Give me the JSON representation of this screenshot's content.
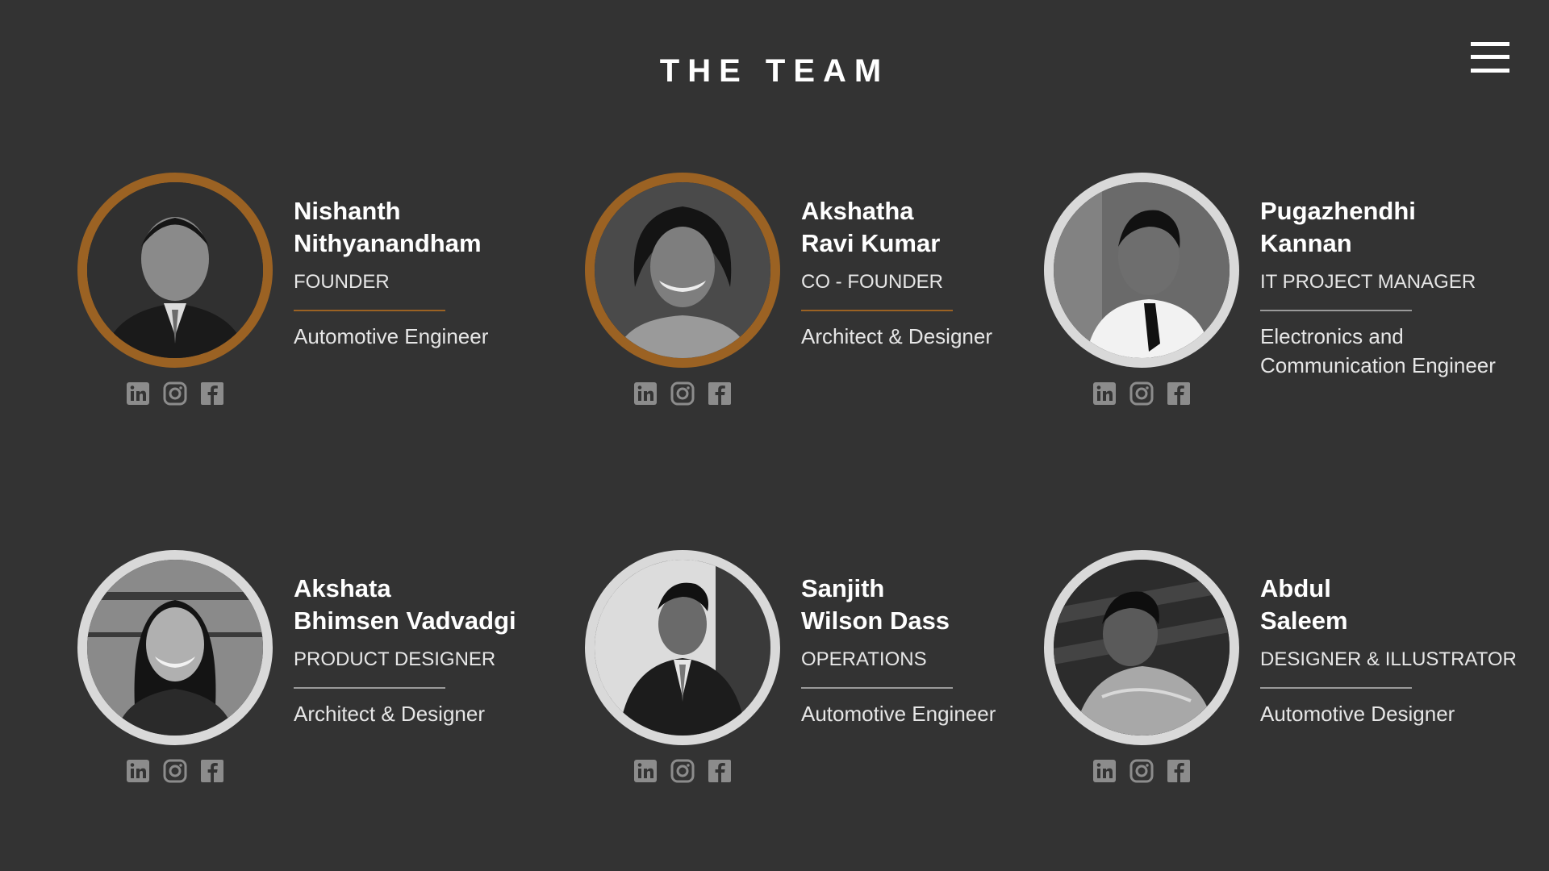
{
  "page": {
    "title": "THE TEAM"
  },
  "header": {
    "menu_icon": "hamburger-menu-icon"
  },
  "colors": {
    "background": "#333333",
    "accent": "#9b6223",
    "ring_default": "#d9d9d9",
    "text": "#ffffff",
    "social_icon": "#8c8c8c"
  },
  "members": [
    {
      "name_line1": "Nishanth",
      "name_line2": "Nithyanandham",
      "role": "FOUNDER",
      "description": "Automotive Engineer",
      "ring": "accent",
      "photo": "portrait-photo",
      "socials": [
        "linkedin-icon",
        "instagram-icon",
        "facebook-icon"
      ]
    },
    {
      "name_line1": "Akshatha",
      "name_line2": "Ravi Kumar",
      "role": "CO - FOUNDER",
      "description": "Architect & Designer",
      "ring": "accent",
      "photo": "portrait-photo",
      "socials": [
        "linkedin-icon",
        "instagram-icon",
        "facebook-icon"
      ]
    },
    {
      "name_line1": "Pugazhendhi",
      "name_line2": "Kannan",
      "role": "IT PROJECT MANAGER",
      "description_line1": "Electronics and",
      "description_line2": "Communication Engineer",
      "ring": "default",
      "photo": "portrait-photo",
      "socials": [
        "linkedin-icon",
        "instagram-icon",
        "facebook-icon"
      ]
    },
    {
      "name_line1": "Akshata",
      "name_line2": "Bhimsen Vadvadgi",
      "role": "PRODUCT DESIGNER",
      "description": "Architect & Designer",
      "ring": "default",
      "photo": "portrait-photo",
      "socials": [
        "linkedin-icon",
        "instagram-icon",
        "facebook-icon"
      ]
    },
    {
      "name_line1": "Sanjith",
      "name_line2": "Wilson Dass",
      "role": "OPERATIONS",
      "description": "Automotive Engineer",
      "ring": "default",
      "photo": "portrait-photo",
      "socials": [
        "linkedin-icon",
        "instagram-icon",
        "facebook-icon"
      ]
    },
    {
      "name_line1": "Abdul",
      "name_line2": "Saleem",
      "role": "DESIGNER & ILLUSTRATOR",
      "description": "Automotive Designer",
      "ring": "default",
      "photo": "portrait-photo",
      "socials": [
        "linkedin-icon",
        "instagram-icon",
        "facebook-icon"
      ]
    }
  ]
}
